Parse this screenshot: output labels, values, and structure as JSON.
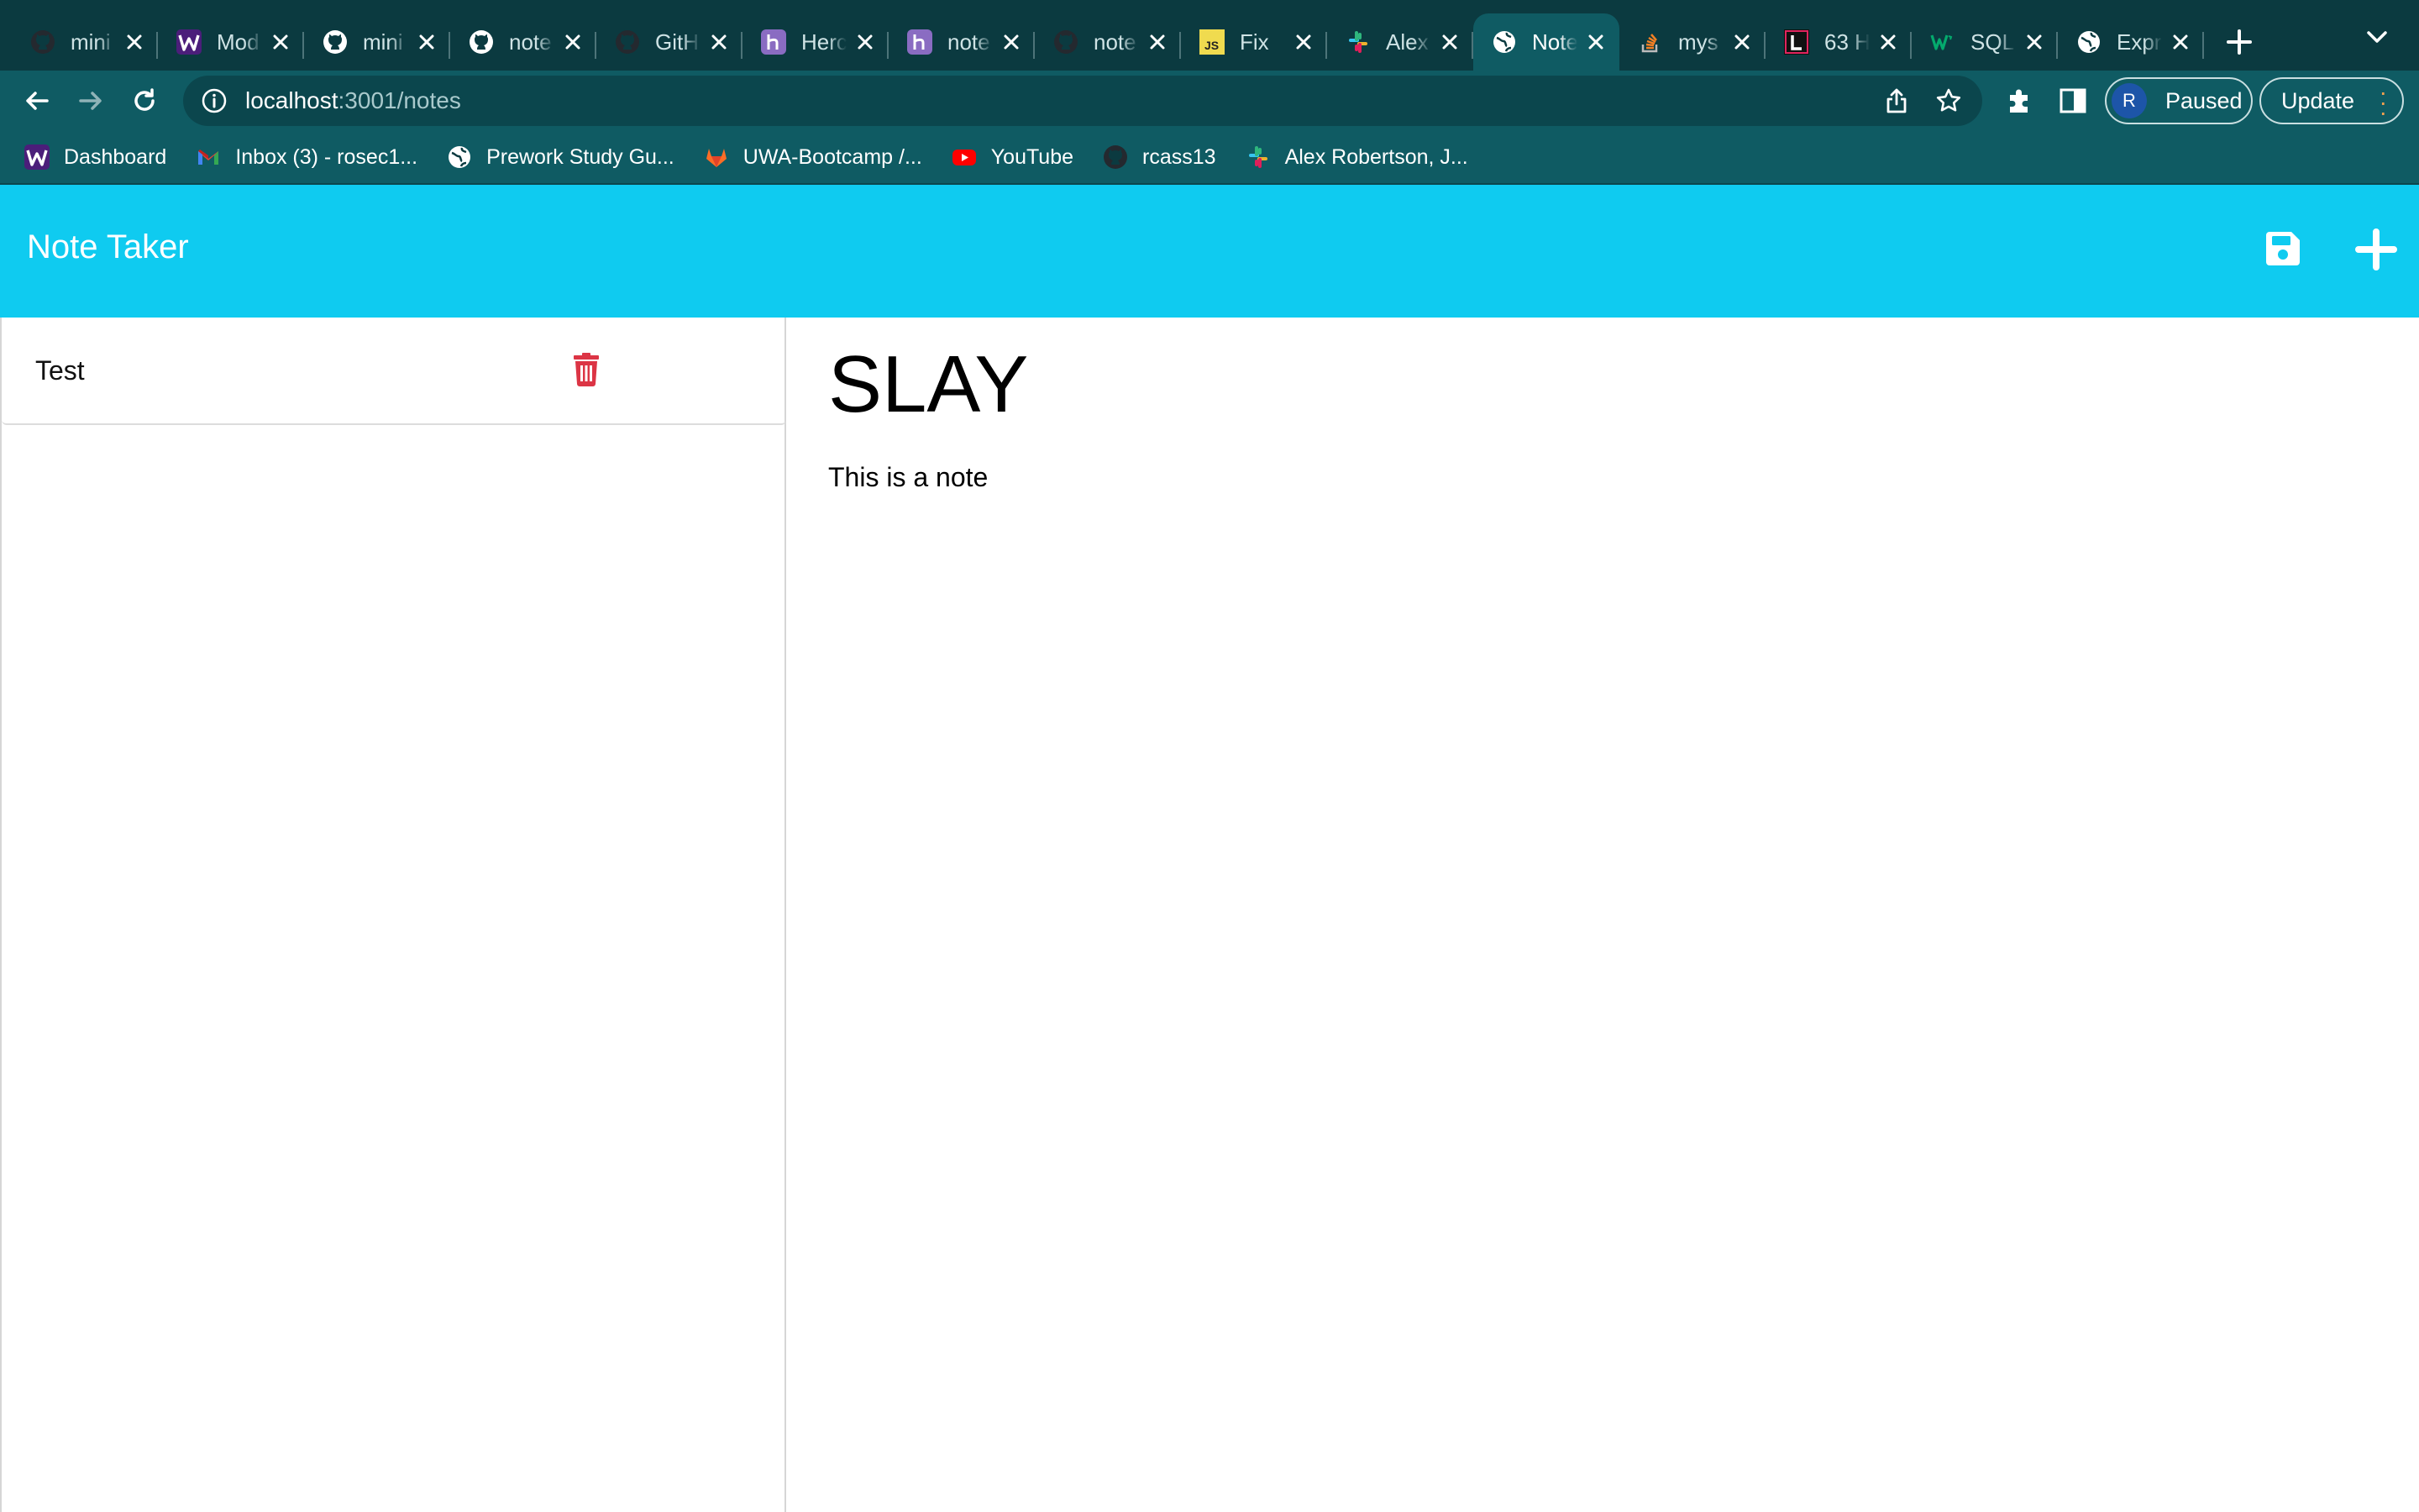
{
  "browser": {
    "tabs": [
      {
        "title": "mini",
        "favicon": "github-icon",
        "color": "#24292f",
        "active": false
      },
      {
        "title": "Mod",
        "favicon": "w-icon",
        "color": "#4b1e7a",
        "active": false
      },
      {
        "title": "mini",
        "favicon": "github-icon",
        "color": "#ffffff",
        "active": false
      },
      {
        "title": "note",
        "favicon": "github-icon",
        "color": "#ffffff",
        "active": false
      },
      {
        "title": "GitH",
        "favicon": "github-icon",
        "color": "#24292f",
        "active": false
      },
      {
        "title": "Herc",
        "favicon": "heroku-icon",
        "color": "#7b5ea7",
        "active": false
      },
      {
        "title": "note",
        "favicon": "heroku-icon",
        "color": "#7b5ea7",
        "active": false
      },
      {
        "title": "note",
        "favicon": "github-icon",
        "color": "#24292f",
        "active": false
      },
      {
        "title": "Fix",
        "favicon": "js-icon",
        "color": "#f0db4f",
        "active": false
      },
      {
        "title": "Alex",
        "favicon": "slack-icon",
        "color": "#e01e5a",
        "active": false
      },
      {
        "title": "Note",
        "favicon": "globe-icon",
        "color": "#ffffff",
        "active": true
      },
      {
        "title": "mys",
        "favicon": "stackoverflow-icon",
        "color": "#f48024",
        "active": false
      },
      {
        "title": "63 H",
        "favicon": "l-icon",
        "color": "#e0245e",
        "active": false
      },
      {
        "title": "SQL",
        "favicon": "w3-icon",
        "color": "#04aa6d",
        "active": false
      },
      {
        "title": "Expr",
        "favicon": "globe-icon",
        "color": "#ffffff",
        "active": false
      }
    ],
    "url_host": "localhost",
    "url_path": ":3001/notes",
    "profile_initial": "R",
    "profile_label": "Paused",
    "update_label": "Update",
    "bookmarks": [
      {
        "label": "Dashboard",
        "icon": "w-icon"
      },
      {
        "label": "Inbox (3) - rosec1...",
        "icon": "gmail-icon"
      },
      {
        "label": "Prework Study Gu...",
        "icon": "globe-icon"
      },
      {
        "label": "UWA-Bootcamp /...",
        "icon": "gitlab-icon"
      },
      {
        "label": "YouTube",
        "icon": "youtube-icon"
      },
      {
        "label": "rcass13",
        "icon": "github-icon"
      },
      {
        "label": "Alex Robertson, J...",
        "icon": "slack-icon"
      }
    ]
  },
  "app": {
    "title": "Note Taker",
    "accent_color": "#0fcbf0",
    "notes": [
      {
        "title": "Test"
      }
    ],
    "active_note": {
      "title": "SLAY",
      "text": "This is a note"
    }
  }
}
